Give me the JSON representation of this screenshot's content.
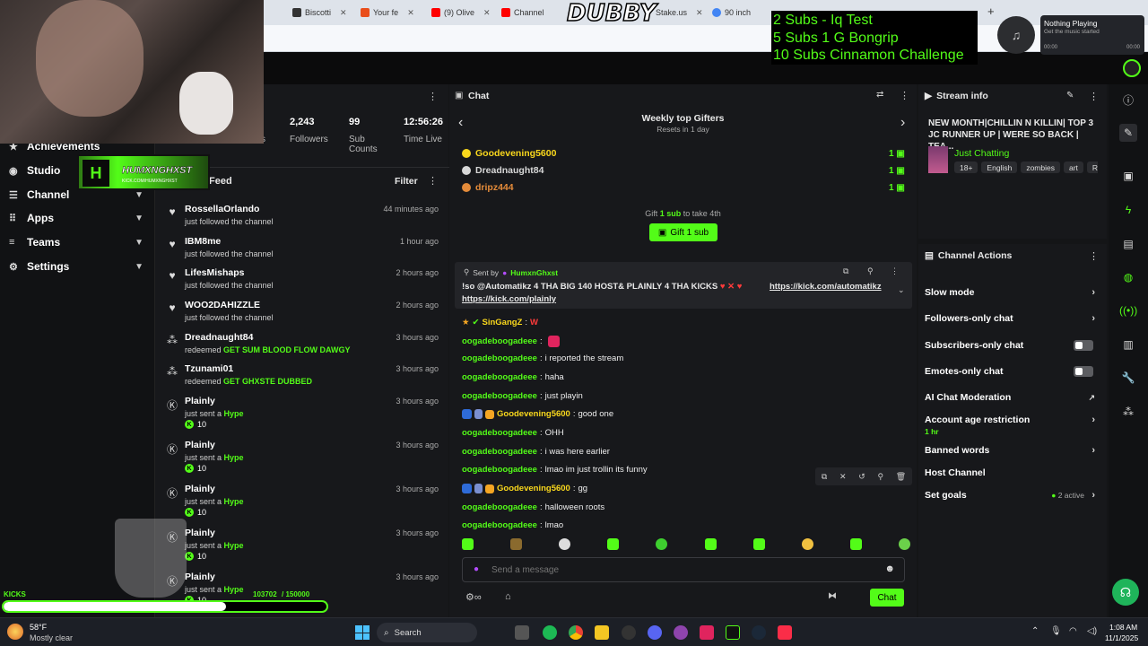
{
  "browser": {
    "tabs": [
      {
        "label": "Biscotti",
        "color": "#333"
      },
      {
        "label": "Your fe",
        "color": "#e94e1b"
      },
      {
        "label": "(9) Olive",
        "color": "#ff0000"
      },
      {
        "label": "Channel",
        "color": "#ff0000"
      },
      {
        "label": "Stake.us",
        "color": "#1a2c38"
      },
      {
        "label": "90 inch",
        "color": "#4285f4"
      }
    ],
    "overlay_logo": "DUBBY"
  },
  "sub_goals": [
    "2 Subs - Iq Test",
    "5 Subs 1 G Bongrip",
    "10 Subs Cinnamon Challenge"
  ],
  "now_playing": {
    "title": "Nothing Playing",
    "subtitle": "Get the music started",
    "start": "00:00",
    "end": "00:00"
  },
  "sidebar": {
    "items": [
      {
        "label": "Achievements",
        "icon": "trophy-icon"
      },
      {
        "label": "Studio",
        "icon": "studio-icon"
      },
      {
        "label": "Channel",
        "icon": "channel-icon"
      },
      {
        "label": "Apps",
        "icon": "apps-icon"
      },
      {
        "label": "Teams",
        "icon": "teams-icon"
      },
      {
        "label": "Settings",
        "icon": "gear-icon"
      }
    ],
    "streamer_tag": "HUMXNGHXST",
    "streamer_sub": "KICK.COM/HUMXNGHXST"
  },
  "stats": {
    "viewers_label": "s",
    "followers_value": "2,243",
    "followers_label": "Followers",
    "subs_value": "99",
    "subs_label": "Sub Counts",
    "time_value": "12:56:26",
    "time_label": "Time Live"
  },
  "feed": {
    "title": "Feed",
    "filter_label": "Filter",
    "items": [
      {
        "name": "RossellaOrlando",
        "action": "just followed the channel",
        "highlight": "",
        "amount": "",
        "time": "44 minutes ago",
        "icon": "heart-icon"
      },
      {
        "name": "IBM8me",
        "action": "just followed the channel",
        "highlight": "",
        "amount": "",
        "time": "1 hour ago",
        "icon": "heart-icon"
      },
      {
        "name": "LifesMishaps",
        "action": "just followed the channel",
        "highlight": "",
        "amount": "",
        "time": "2 hours ago",
        "icon": "heart-icon"
      },
      {
        "name": "WOO2DAHIZZLE",
        "action": "just followed the channel",
        "highlight": "",
        "amount": "",
        "time": "2 hours ago",
        "icon": "heart-icon"
      },
      {
        "name": "Dreadnaught84",
        "action": "redeemed",
        "highlight": "GET SUM BLOOD FLOW DAWGY",
        "amount": "",
        "time": "3 hours ago",
        "icon": "redeem-icon"
      },
      {
        "name": "Tzunami01",
        "action": "redeemed",
        "highlight": "GET GHXSTE DUBBED",
        "amount": "",
        "time": "3 hours ago",
        "icon": "redeem-icon"
      },
      {
        "name": "Plainly",
        "action": "just sent a",
        "highlight": "Hype",
        "amount": "10",
        "time": "3 hours ago",
        "icon": "kick-icon"
      },
      {
        "name": "Plainly",
        "action": "just sent a",
        "highlight": "Hype",
        "amount": "10",
        "time": "3 hours ago",
        "icon": "kick-icon"
      },
      {
        "name": "Plainly",
        "action": "just sent a",
        "highlight": "Hype",
        "amount": "10",
        "time": "3 hours ago",
        "icon": "kick-icon"
      },
      {
        "name": "Plainly",
        "action": "just sent a",
        "highlight": "Hype",
        "amount": "10",
        "time": "3 hours ago",
        "icon": "kick-icon"
      },
      {
        "name": "Plainly",
        "action": "just sent a",
        "highlight": "Hype",
        "amount": "10",
        "time": "3 hours ago",
        "icon": "kick-icon"
      }
    ]
  },
  "kicks_bar": {
    "label": "KICKS",
    "progress": "103702",
    "goal": "/ 150000",
    "fraction": 0.69
  },
  "chat": {
    "title": "Chat",
    "gifters_title": "Weekly top Gifters",
    "gifters_sub": "Resets in 1 day",
    "gifters": [
      {
        "name": "Goodevening5600",
        "count": "1",
        "color": "#f9d71c"
      },
      {
        "name": "Dreadnaught84",
        "count": "1",
        "color": "#d8d8d8"
      },
      {
        "name": "dripz444",
        "count": "1",
        "color": "#e48b3a"
      }
    ],
    "gift_line_pre": "Gift",
    "gift_line_amt": "1 sub",
    "gift_line_post": "to take 4th",
    "gift_button": "Gift 1 sub",
    "pinned_sent_by": "Sent by",
    "pinned_user": "HumxnGhxst",
    "pinned_text": "!so @Automatikz 4 THA BIG 140 HOST& PLAINLY 4 THA KICKS",
    "pinned_link1": "https://kick.com/automatikz",
    "pinned_link2": "https://kick.com/plainly",
    "messages": [
      {
        "user": "SinGangZ",
        "text": "W",
        "style": "uy"
      },
      {
        "user": "oogadeboogadeee",
        "text": "",
        "style": "u"
      },
      {
        "user": "oogadeboogadeee",
        "text": "i reported the stream",
        "style": "u"
      },
      {
        "user": "oogadeboogadeee",
        "text": "haha",
        "style": "u"
      },
      {
        "user": "oogadeboogadeee",
        "text": "just playin",
        "style": "u"
      },
      {
        "user": "Goodevening5600",
        "text": "good one",
        "style": "uy"
      },
      {
        "user": "oogadeboogadeee",
        "text": "OHH",
        "style": "u"
      },
      {
        "user": "oogadeboogadeee",
        "text": "i was here earlier",
        "style": "u"
      },
      {
        "user": "oogadeboogadeee",
        "text": "lmao im just trollin its funny",
        "style": "u"
      },
      {
        "user": "Goodevening5600",
        "text": "gg",
        "style": "uy"
      },
      {
        "user": "oogadeboogadeee",
        "text": "halloween roots",
        "style": "u"
      },
      {
        "user": "oogadeboogadeee",
        "text": "lmao",
        "style": "u"
      }
    ],
    "input_placeholder": "Send a message",
    "send_label": "Chat"
  },
  "stream_info": {
    "title": "Stream info",
    "stream_title": "NEW MONTH|CHILLIN N KILLIN| TOP 3 JC RUNNER UP | WERE SO BACK | TEA...",
    "category": "Just Chatting",
    "tags": [
      "18+",
      "English",
      "zombies",
      "art",
      "Re"
    ]
  },
  "channel_actions": {
    "title": "Channel Actions",
    "items": [
      {
        "label": "Slow mode",
        "control": "chevron"
      },
      {
        "label": "Followers-only chat",
        "control": "chevron"
      },
      {
        "label": "Subscribers-only chat",
        "control": "toggle"
      },
      {
        "label": "Emotes-only chat",
        "control": "toggle"
      },
      {
        "label": "AI Chat Moderation",
        "control": "external"
      },
      {
        "label": "Account age restriction",
        "control": "chevron",
        "sub": "1 hr"
      },
      {
        "label": "Banned words",
        "control": "chevron"
      },
      {
        "label": "Host Channel",
        "control": "none"
      },
      {
        "label": "Set goals",
        "control": "chevron",
        "status": "2 active"
      }
    ]
  },
  "taskbar": {
    "weather_temp": "58°F",
    "weather_desc": "Mostly clear",
    "search_label": "Search",
    "time": "1:08 AM",
    "date": "11/1/2025"
  },
  "colors": {
    "kick_green": "#53fc18",
    "bg": "#141517",
    "panel": "#17181b"
  }
}
